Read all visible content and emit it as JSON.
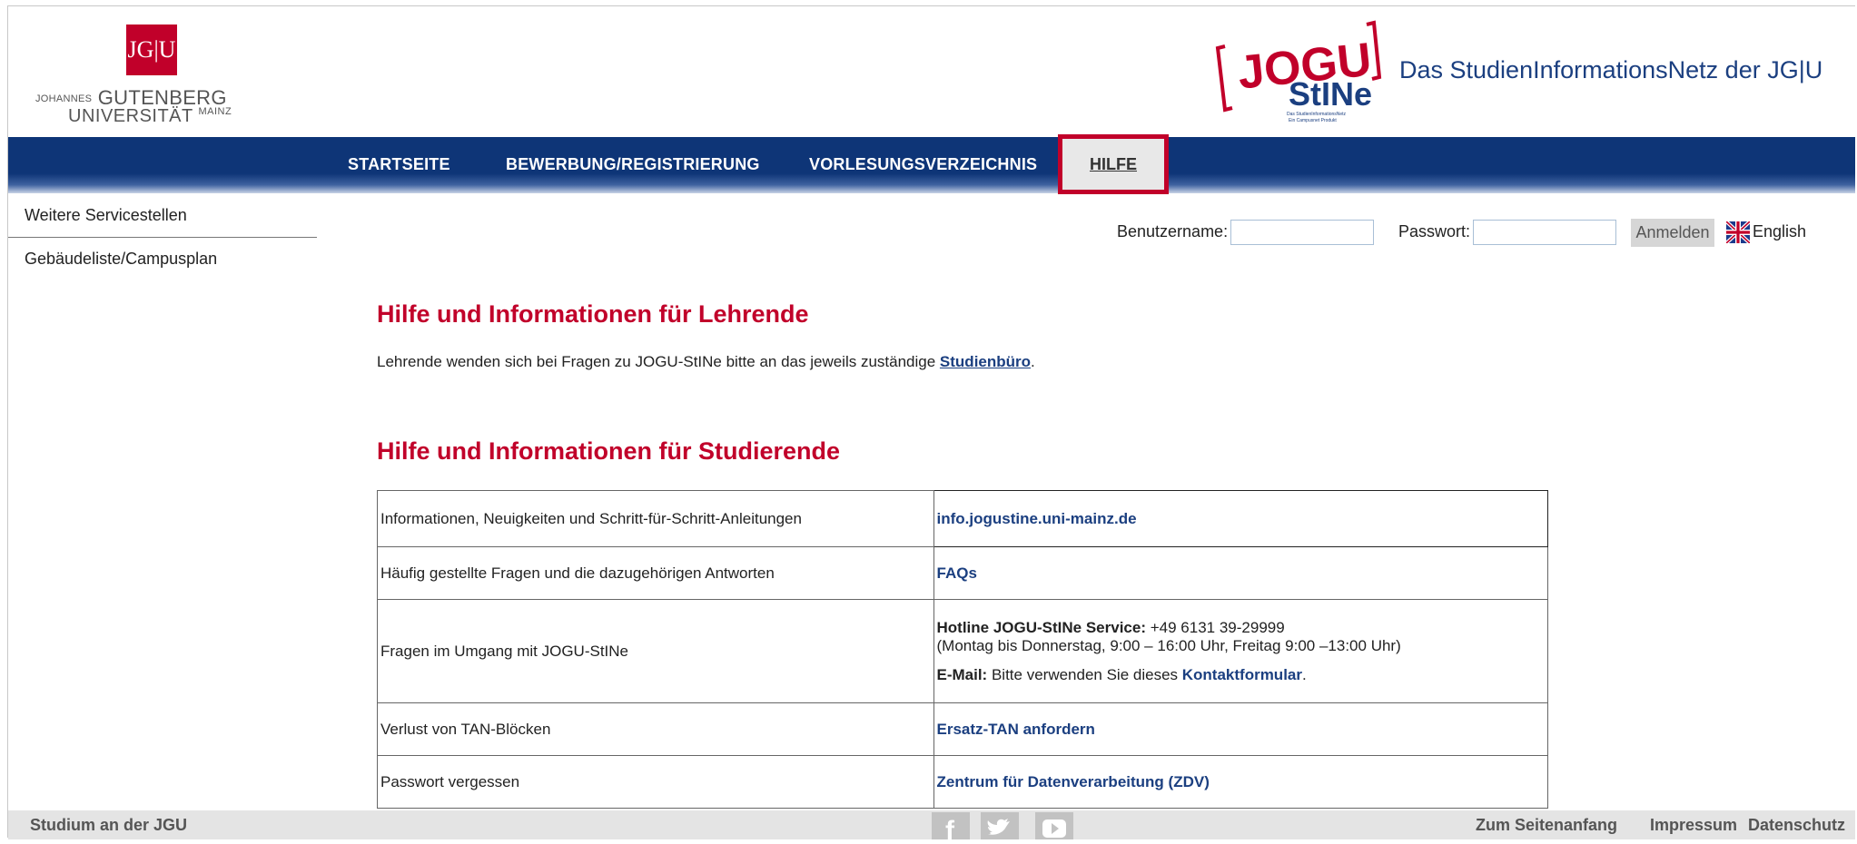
{
  "header": {
    "logo_box_text": "JG|U",
    "logo_line1_small": "JOHANNES",
    "logo_line1": "GUTENBERG",
    "logo_line2": "UNIVERSITÄT",
    "logo_line2_small": "MAINZ",
    "stine_logo_text": "JOGU StINe",
    "stine_logo_subtext": "Das StudienInformationsNetz Ein Campusnet Produkt",
    "site_title": "Das StudienInformationsNetz der JG|U"
  },
  "nav": {
    "items": [
      "STARTSEITE",
      "BEWERBUNG/REGISTRIERUNG",
      "VORLESUNGSVERZEICHNIS",
      "HILFE"
    ],
    "active_index": 3
  },
  "sidebar": {
    "items": [
      "Weitere Servicestellen",
      "Gebäudeliste/Campusplan"
    ]
  },
  "login": {
    "username_label": "Benutzername:",
    "username_value": "",
    "password_label": "Passwort:",
    "password_value": "",
    "submit_label": "Anmelden",
    "language_link": "English"
  },
  "main": {
    "teachers_heading": "Hilfe und Informationen für Lehrende",
    "teachers_text": "Lehrende wenden sich bei Fragen zu JOGU-StINe bitte an das jeweils zuständige",
    "teachers_link": "Studienbüro",
    "teachers_text_end": ".",
    "students_heading": "Hilfe und Informationen für Studierende",
    "table": [
      {
        "topic": "Informationen, Neuigkeiten und Schritt-für-Schritt-Anleitungen",
        "link": "info.jogustine.uni-mainz.de"
      },
      {
        "topic": "Häufig gestellte Fragen und die dazugehörigen Antworten",
        "link": "FAQs"
      },
      {
        "topic": "Fragen im Umgang mit JOGU-StINe",
        "hotline_label": "Hotline JOGU-StINe Service:",
        "hotline_number": " +49 6131 39-29999",
        "hotline_hours": "(Montag bis Donnerstag, 9:00 – 16:00 Uhr, Freitag 9:00 –13:00 Uhr)",
        "mail_label": "E-Mail:",
        "mail_text": " Bitte verwenden Sie dieses ",
        "mail_link": "Kontaktformular",
        "mail_end": "."
      },
      {
        "topic": "Verlust von TAN-Blöcken",
        "link": "Ersatz-TAN anfordern"
      },
      {
        "topic": "Passwort vergessen",
        "link": "Zentrum für Datenverarbeitung (ZDV)"
      }
    ]
  },
  "footer": {
    "left": "Studium an der JGU",
    "social_icons": [
      "facebook-icon",
      "twitter-icon",
      "youtube-icon"
    ],
    "to_top": "Zum Seitenanfang",
    "imprint": "Impressum",
    "privacy": "Datenschutz"
  },
  "colors": {
    "brand_red": "#c1002a",
    "nav_blue": "#0e3577",
    "link_blue": "#1b3f80"
  }
}
